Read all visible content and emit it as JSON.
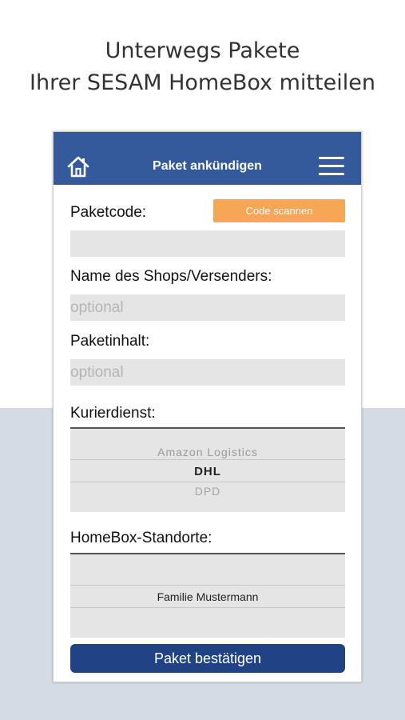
{
  "headline": {
    "line1": "Unterwegs Pakete",
    "line2": "Ihrer SESAM HomeBox mitteilen"
  },
  "navbar": {
    "title": "Paket ankündigen",
    "home_icon": "home-icon",
    "menu_icon": "hamburger-menu-icon",
    "color": "#345a9c"
  },
  "form": {
    "paketcode_label": "Paketcode:",
    "scan_button_label": "Code scannen",
    "paketcode_value": "",
    "shop_label": "Name des Shops/Versenders:",
    "shop_placeholder": "optional",
    "inhalt_label": "Paketinhalt:",
    "inhalt_placeholder": "optional",
    "kurier_label": "Kurierdienst:",
    "kurier_options": [
      "Amazon Logistics",
      "DHL",
      "DPD"
    ],
    "kurier_selected": "DHL",
    "standorte_label": "HomeBox-Standorte:",
    "standorte_options": [
      "Familie Mustermann"
    ],
    "standorte_selected": "Familie Mustermann",
    "confirm_button_label": "Paket bestätigen"
  },
  "colors": {
    "accent_orange": "#f7a655",
    "primary_blue": "#1f4384",
    "background_lower": "#d3dbe5"
  }
}
